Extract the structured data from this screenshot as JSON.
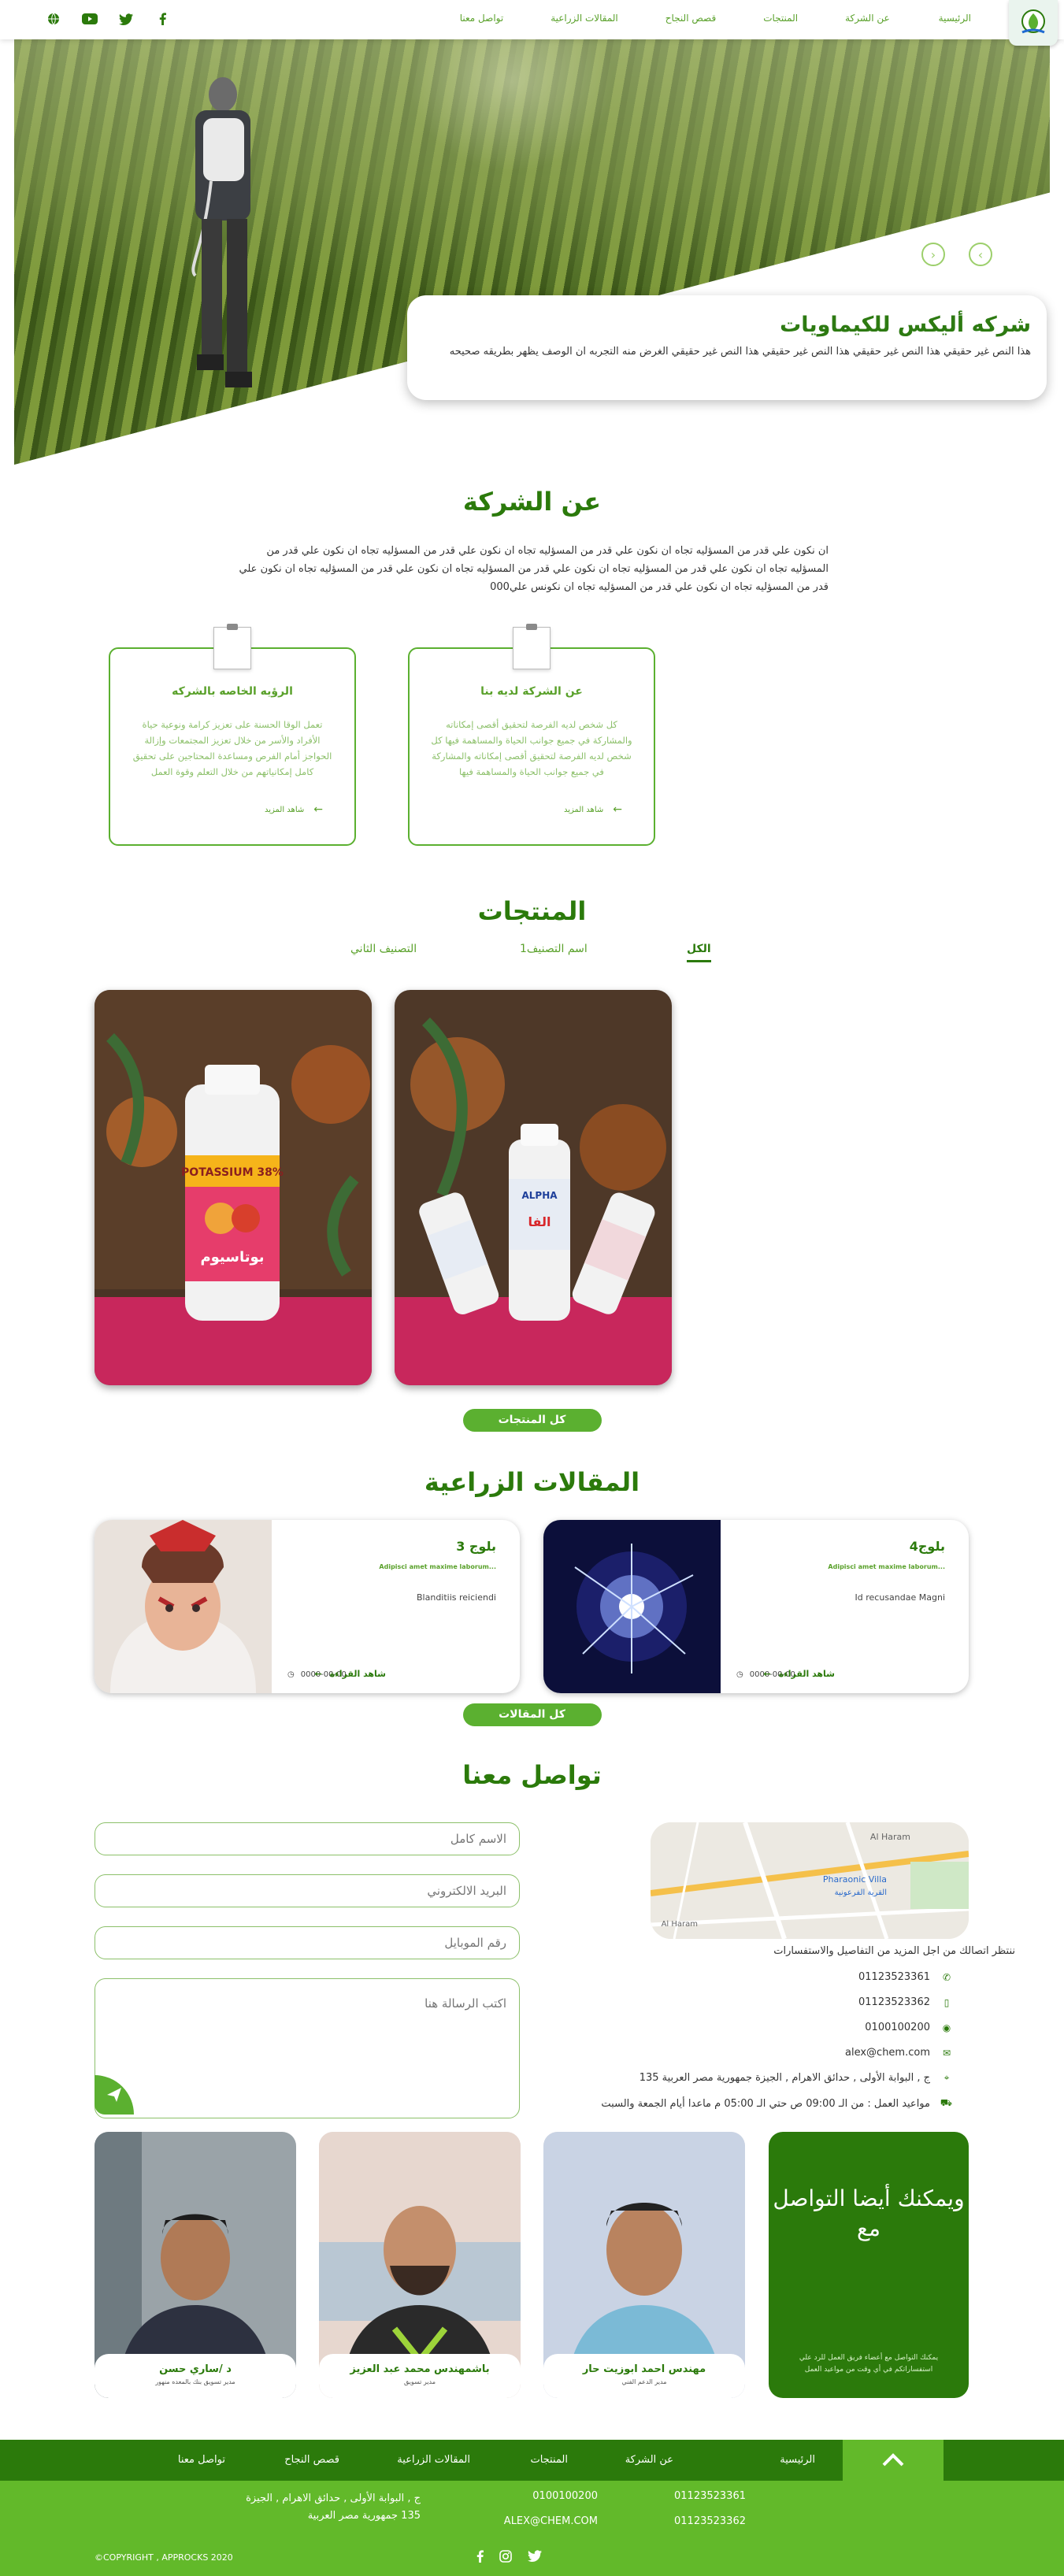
{
  "nav": {
    "home": "الرئيسية",
    "about": "عن الشركة",
    "products": "المنتجات",
    "success": "قصص النجاح",
    "articles": "المقالات الزراعية",
    "contact": "تواصل معنا"
  },
  "social_icons": [
    "globe-icon",
    "youtube-icon",
    "twitter-icon",
    "facebook-icon"
  ],
  "hero": {
    "title": "شركه أليكس للكيماويات",
    "text": "هذا النص غير حقيقي هذا النص غير حقيقي هذا النص غير حقيقي هذا النص غير حقيقي الغرض منه التجربه ان الوصف يظهر بطريقه صحيحه"
  },
  "about": {
    "title": "عن الشركة",
    "text": "ان نكون علي قدر من المسؤليه تجاه ان نكون علي قدر من المسؤليه تجاه ان نكون علي قدر من المسؤليه تجاه ان نكون علي قدر من المسؤليه تجاه ان نكون علي قدر من المسؤليه تجاه ان نكون علي قدر من المسؤليه تجاه ان نكون علي قدر من المسؤليه تجاه ان نكون علي قدر من المسؤليه تجاه ان نكون علي قدر من المسؤليه تجاه ان نكونس علي000",
    "cards": [
      {
        "title": "الرؤيه الخاصه بالشركه",
        "text": "تعمل الوقا الحسنة على تعزيز كرامة ونوعية حياة الأفراد والأسر من خلال تعزيز المجتمعات وإزالة الحواجز أمام الفرص ومساعدة المحتاجين على تحقيق كامل إمكانياتهم من خلال التعلم وقوة العمل",
        "more": "شاهد المزيد"
      },
      {
        "title": "عن الشركة لديه بنا",
        "text": "كل شخص لديه الفرصة لتحقيق أقصى إمكاناته والمشاركة في جميع جوانب الحياة والمساهمة فيها كل شخص لديه الفرصة لتحقيق أقصى إمكاناته والمشاركة في جميع جوانب الحياة والمساهمة فيها",
        "more": "شاهد المزيد"
      }
    ]
  },
  "products": {
    "title": "المنتجات",
    "tabs": [
      "الكل",
      "اسم التصنيف1",
      "التصنيف الثاني"
    ],
    "all_button": "كل المنتجات",
    "items": [
      {
        "label_ar": "بوتاسيوم",
        "label_en": "POTASSIUM 38%"
      },
      {
        "label_ar": "الفا",
        "label_en": "ALPHA"
      }
    ]
  },
  "articles": {
    "title": "المقالات الزراعية",
    "all_button": "كل المقالات",
    "items": [
      {
        "title": "بلوج4",
        "sub": "Adipisci amet maxime laborum...",
        "text": "Id recusandae Magni",
        "date": "0000-00-00",
        "read": "شاهد القراءة"
      },
      {
        "title": "بلوج 3",
        "sub": "Adipisci amet maxime laborum...",
        "text": "Blanditiis reiciendi",
        "date": "0000-00-00",
        "read": "شاهد القراءة"
      }
    ]
  },
  "contact": {
    "title": "تواصل معنا",
    "placeholders": {
      "name": "الاسم كامل",
      "email": "البريد الالكتروني",
      "mobile": "رقم الموبايل",
      "message": "اكتب الرسالة هنا"
    },
    "map": {
      "label1": "Al Haram",
      "label2": "Pharaonic Villa",
      "label3": "القرية الفرعونية",
      "label4": "Al Haram"
    },
    "intro": "ننتظر اتصالك من اجل المزيد من التفاصيل والاستفسارات",
    "phone1": "01123523361",
    "phone2": "01123523362",
    "phone3": "0100100200",
    "email": "alex@chem.com",
    "address": "ج , البوابة الأولى , حدائق الاهرام , الجيزة جمهورية مصر العربية 135",
    "hours": "مواعيد العمل : من الـ 09:00 ص حتي الـ 05:00 م ماعدا أيام الجمعة والسبت"
  },
  "team": {
    "lead_title": "ويمكنك أيضا التواصل مع",
    "lead_text": "يمكنك التواصل مع أعضاء فريق العمل للرد علي استفساراتكم في أي وقت من مواعيد العمل",
    "members": [
      {
        "name": "مهندس احمد ابوزيت حار",
        "role": "مدير الدعم الفني"
      },
      {
        "name": "باشمهندس محمد عبد العزيز",
        "role": "مدير تسويق"
      },
      {
        "name": "د /ساري حسن",
        "role": "مدير تسويق بنك بالمعده منهور"
      }
    ]
  },
  "footer": {
    "nav": [
      "الرئيسية",
      "عن الشركة",
      "المنتجات",
      "المقالات الزراعية",
      "قصص النجاح",
      "تواصل معنا"
    ],
    "phone1": "01123523361",
    "phone2": "01123523362",
    "phone3": "0100100200",
    "email": "ALEX@CHEM.COM",
    "address": "ج , البوابة الأولى , حدائق الاهرام , الجيزة 135 جمهورية مصر العربية",
    "copyright": "©COPYRIGHT , APPROCKS 2020"
  },
  "colors": {
    "primary": "#2b7a0b",
    "accent": "#5bb030",
    "light": "#8cc06a"
  }
}
